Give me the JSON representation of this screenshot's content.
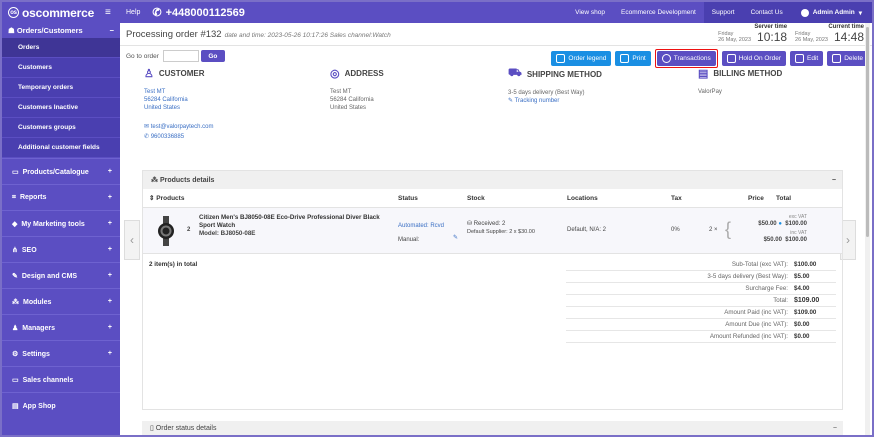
{
  "topbar": {
    "logo": "oscommerce",
    "help": "Help",
    "phone": "+448000112569",
    "links": [
      "View shop",
      "Ecommerce Development",
      "Support",
      "Contact Us"
    ],
    "admin": "Admin Admin"
  },
  "sidebar": {
    "section": "Orders/Customers",
    "subitems": [
      "Orders",
      "Customers",
      "Temporary orders",
      "Customers Inactive",
      "Customers groups",
      "Additional customer fields"
    ],
    "items": [
      {
        "label": "Products/Catalogue",
        "icon": "folder-icon"
      },
      {
        "label": "Reports",
        "icon": "chart-icon"
      },
      {
        "label": "My Marketing tools",
        "icon": "tag-icon"
      },
      {
        "label": "SEO",
        "icon": "sitemap-icon"
      },
      {
        "label": "Design and CMS",
        "icon": "pencil-icon"
      },
      {
        "label": "Modules",
        "icon": "modules-icon"
      },
      {
        "label": "Managers",
        "icon": "user-icon"
      },
      {
        "label": "Settings",
        "icon": "gear-icon"
      },
      {
        "label": "Sales channels",
        "icon": "monitor-icon"
      },
      {
        "label": "App Shop",
        "icon": "shop-icon"
      }
    ]
  },
  "header": {
    "title": "Processing order #132",
    "meta": "date and time: 2023-05-26 10:17:26  Sales channel:Watch",
    "server_caption": "Server time",
    "server_day": "Friday",
    "server_date": "26 May, 2023",
    "server_time": "10:18",
    "current_caption": "Current time",
    "current_day": "Friday",
    "current_date": "26 May, 2023",
    "current_time": "14:48"
  },
  "toolbar": {
    "goto_label": "Go to order",
    "go": "Go",
    "order_legend": "Order legend",
    "print": "Print",
    "transactions": "Transactions",
    "hold": "Hold On Order",
    "edit": "Edit",
    "delete": "Delete"
  },
  "customer": {
    "title": "CUSTOMER",
    "name": "Test MT",
    "line2": "56284 California",
    "line3": "United States",
    "email": "test@valorpaytech.com",
    "phone": "9600336885"
  },
  "address": {
    "title": "ADDRESS",
    "name": "Test MT",
    "line2": "56284 California",
    "line3": "United States"
  },
  "shipping": {
    "title": "SHIPPING METHOD",
    "method": "3-5 days delivery (Best Way)",
    "tracking": "Tracking number"
  },
  "billing": {
    "title": "BILLING METHOD",
    "method": "ValorPay"
  },
  "products": {
    "panel_title": "Products details",
    "columns": [
      "Products",
      "Status",
      "Stock",
      "Locations",
      "Tax",
      "Price",
      "Total"
    ],
    "row": {
      "qty": "2",
      "name": "Citizen Men's BJ8050-08E Eco-Drive Professional Diver Black Sport Watch",
      "model": "Model: BJ8050-08E",
      "status1": "Automated: Rcvd",
      "status2": "Manual:",
      "stock1": "Received:  2",
      "stock2": "Default Supplier: 2 x $30.00",
      "location": "Default, N/A: 2",
      "tax": "0%",
      "price_qty": "2 ×",
      "exc_vat": "exc VAT",
      "price_exc": "$50.00",
      "total_exc": "$100.00",
      "inc_vat": "inc VAT",
      "price_inc": "$50.00",
      "total_inc": "$100.00"
    },
    "count": "2 item(s) in total"
  },
  "totals": [
    {
      "label": "Sub-Total (exc VAT):",
      "value": "$100.00"
    },
    {
      "label": "3-5 days delivery (Best Way):",
      "value": "$5.00"
    },
    {
      "label": "Surcharge Fee:",
      "value": "$4.00"
    },
    {
      "label": "Total:",
      "value": "$109.00"
    },
    {
      "label": "Amount Paid (inc VAT):",
      "value": "$109.00"
    },
    {
      "label": "Amount Due (inc VAT):",
      "value": "$0.00"
    },
    {
      "label": "Amount Refunded (inc VAT):",
      "value": "$0.00"
    }
  ],
  "status_panel": "Order status details",
  "colors": {
    "brand": "#5b4ec2",
    "accent": "#1a8fe3",
    "highlight": "#e11111"
  }
}
